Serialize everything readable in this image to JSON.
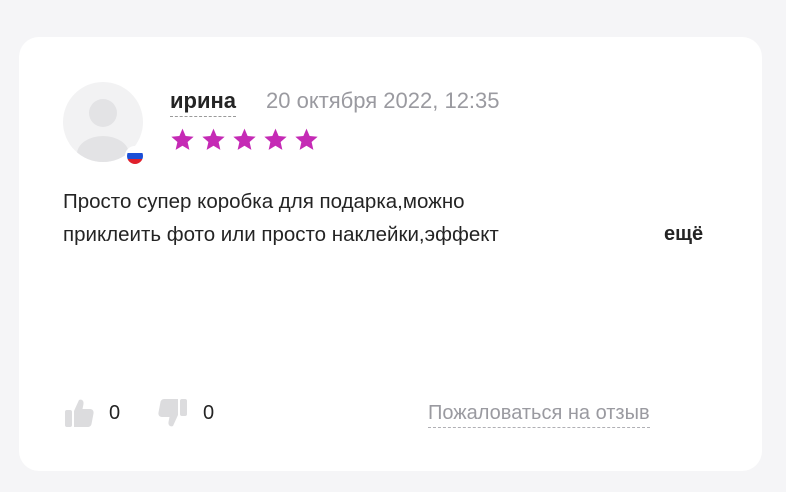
{
  "review": {
    "author": "ирина",
    "date": "20 октября 2022, 12:35",
    "rating": 5,
    "rating_max": 5,
    "star_color": "#c52ab5",
    "country_flag": "ru-flag",
    "text_lines": [
      "Просто супер коробка для подарка,можно",
      "приклеить фото или просто наклейки,эффект"
    ],
    "more_label": "ещё",
    "likes": "0",
    "dislikes": "0",
    "report_label": "Пожаловаться на отзыв"
  }
}
